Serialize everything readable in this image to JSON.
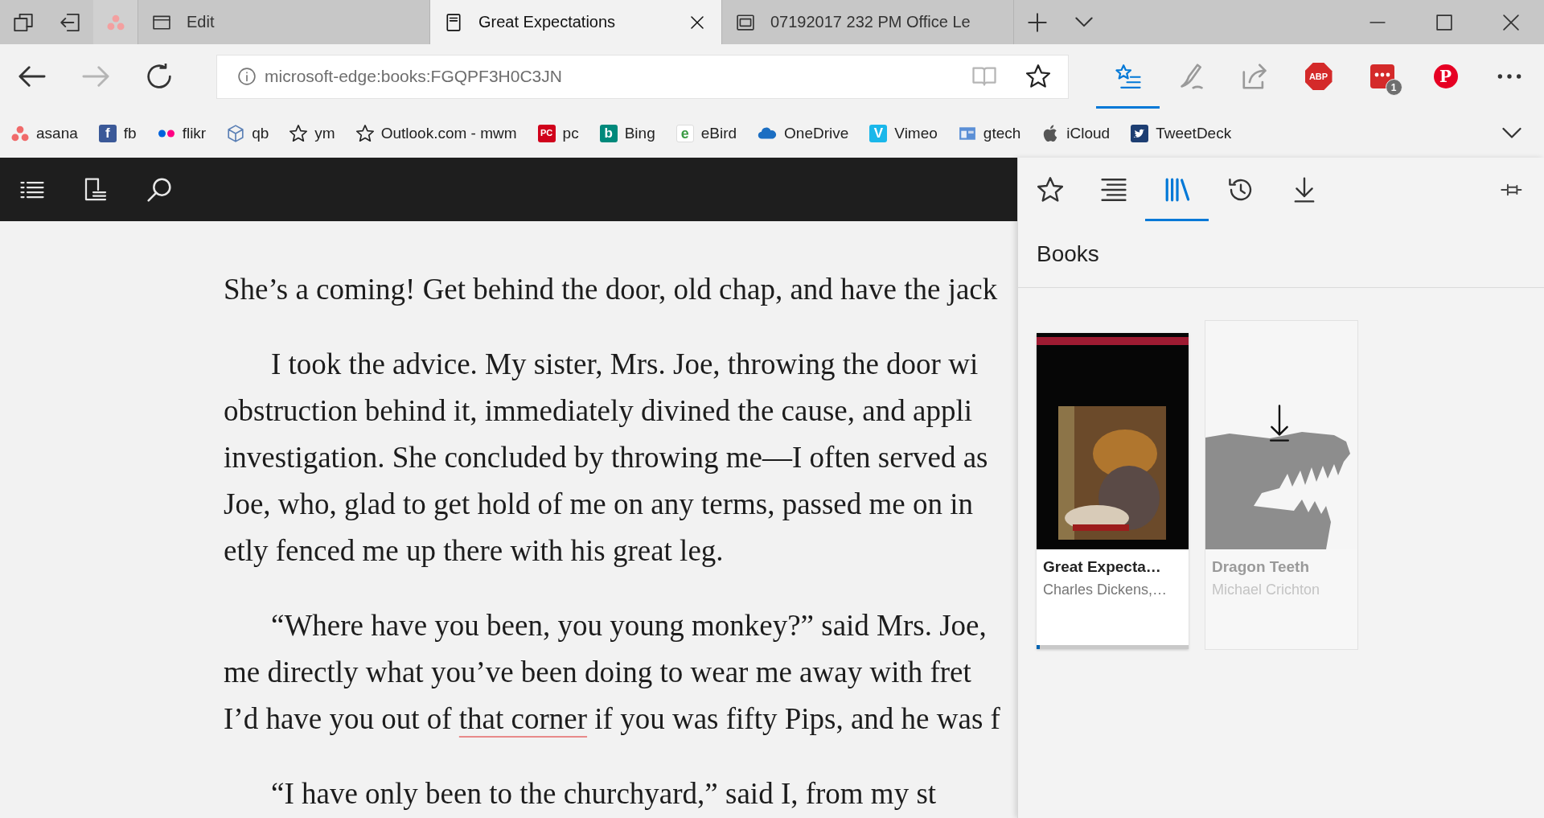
{
  "tabbar": {
    "tabs": [
      {
        "kind": "pinned",
        "selected": false
      },
      {
        "kind": "page",
        "title": "Edit",
        "selected": false
      },
      {
        "kind": "book",
        "title": "Great Expectations",
        "selected": true
      },
      {
        "kind": "pdf",
        "title": "07192017 232 PM Office Le",
        "selected": false
      }
    ]
  },
  "toolbar": {
    "nav": [
      {
        "kind": "back",
        "disabled": false
      },
      {
        "kind": "forward",
        "disabled": true
      },
      {
        "kind": "refresh",
        "disabled": false
      }
    ],
    "address": {
      "value": "microsoft-edge:books:FGQPF3H0C3JN",
      "reading_view": {
        "disabled": true
      }
    },
    "actions": [
      {
        "kind": "hub",
        "selected": true,
        "disabled": false
      },
      {
        "kind": "note",
        "selected": false,
        "disabled": true
      },
      {
        "kind": "share",
        "selected": false,
        "disabled": true
      }
    ],
    "extensions": [
      {
        "kind": "octagon",
        "label": "ABP"
      },
      {
        "kind": "chat",
        "badge": "1"
      },
      {
        "kind": "circle",
        "label": "P"
      }
    ]
  },
  "favorites": [
    {
      "kind": "dots",
      "label": "asana"
    },
    {
      "kind": "tile",
      "label": "fb",
      "letter": "f",
      "color": "#3b5998"
    },
    {
      "kind": "twodots",
      "label": "flikr"
    },
    {
      "kind": "cube",
      "label": "qb"
    },
    {
      "kind": "star",
      "label": "ym"
    },
    {
      "kind": "star",
      "label": "Outlook.com - mwm"
    },
    {
      "kind": "tile",
      "label": "pc",
      "letter": "PC",
      "color": "#d0021b"
    },
    {
      "kind": "tile",
      "label": "Bing",
      "letter": "b",
      "color": "#00897b"
    },
    {
      "kind": "letter",
      "label": "eBird",
      "letter": "e",
      "color": "#3a9b43"
    },
    {
      "kind": "cloud",
      "label": "OneDrive"
    },
    {
      "kind": "tile",
      "label": "Vimeo",
      "letter": "V",
      "color": "#1ab7ea"
    },
    {
      "kind": "window",
      "label": "gtech"
    },
    {
      "kind": "apple",
      "label": "iCloud"
    },
    {
      "kind": "bird",
      "label": "TweetDeck"
    }
  ],
  "reader": {
    "paragraphs": [
      {
        "indented": false,
        "lines": [
          [
            {
              "text": "She’s a coming! Get behind the door, old chap, and have the jack",
              "underlined": false
            }
          ]
        ]
      },
      {
        "indented": true,
        "lines": [
          [
            {
              "text": "I took the advice. My sister, Mrs. Joe, throwing the door wi",
              "underlined": false
            }
          ],
          [
            {
              "text": "obstruction behind it, immediately divined the cause, and appli",
              "underlined": false
            }
          ],
          [
            {
              "text": "investigation. She concluded by throwing me—I often served as",
              "underlined": false
            }
          ],
          [
            {
              "text": "Joe, who, glad to get hold of me on any terms, passed me on in",
              "underlined": false
            }
          ],
          [
            {
              "text": "etly fenced me up there with his great leg.",
              "underlined": false
            }
          ]
        ]
      },
      {
        "indented": true,
        "lines": [
          [
            {
              "text": "“Where have you been, you young monkey?” said Mrs. Joe,",
              "underlined": false
            }
          ],
          [
            {
              "text": "me directly what you’ve been doing to wear me away with fret",
              "underlined": false
            }
          ],
          [
            {
              "text": "I’d have you out of ",
              "underlined": false
            },
            {
              "text": "that corner",
              "underlined": true
            },
            {
              "text": " if you was fifty Pips, and he was f",
              "underlined": false
            }
          ]
        ]
      },
      {
        "indented": true,
        "lines": [
          [
            {
              "text": "“I have only been to the churchyard,” said I, from my st",
              "underlined": false
            }
          ]
        ]
      }
    ]
  },
  "hub": {
    "tabs": [
      {
        "kind": "favorites",
        "selected": false
      },
      {
        "kind": "reading_list",
        "selected": false
      },
      {
        "kind": "books",
        "selected": true
      },
      {
        "kind": "history",
        "selected": false
      },
      {
        "kind": "downloads",
        "selected": false
      }
    ],
    "title": "Books",
    "books": [
      {
        "kind": "painting",
        "title": "Great Expecta…",
        "author": "Charles Dickens,…",
        "downloaded": true,
        "level": 0.02
      },
      {
        "kind": "skull",
        "title": "Dragon Teeth",
        "author": "Michael Crichton",
        "downloaded": false
      }
    ]
  }
}
